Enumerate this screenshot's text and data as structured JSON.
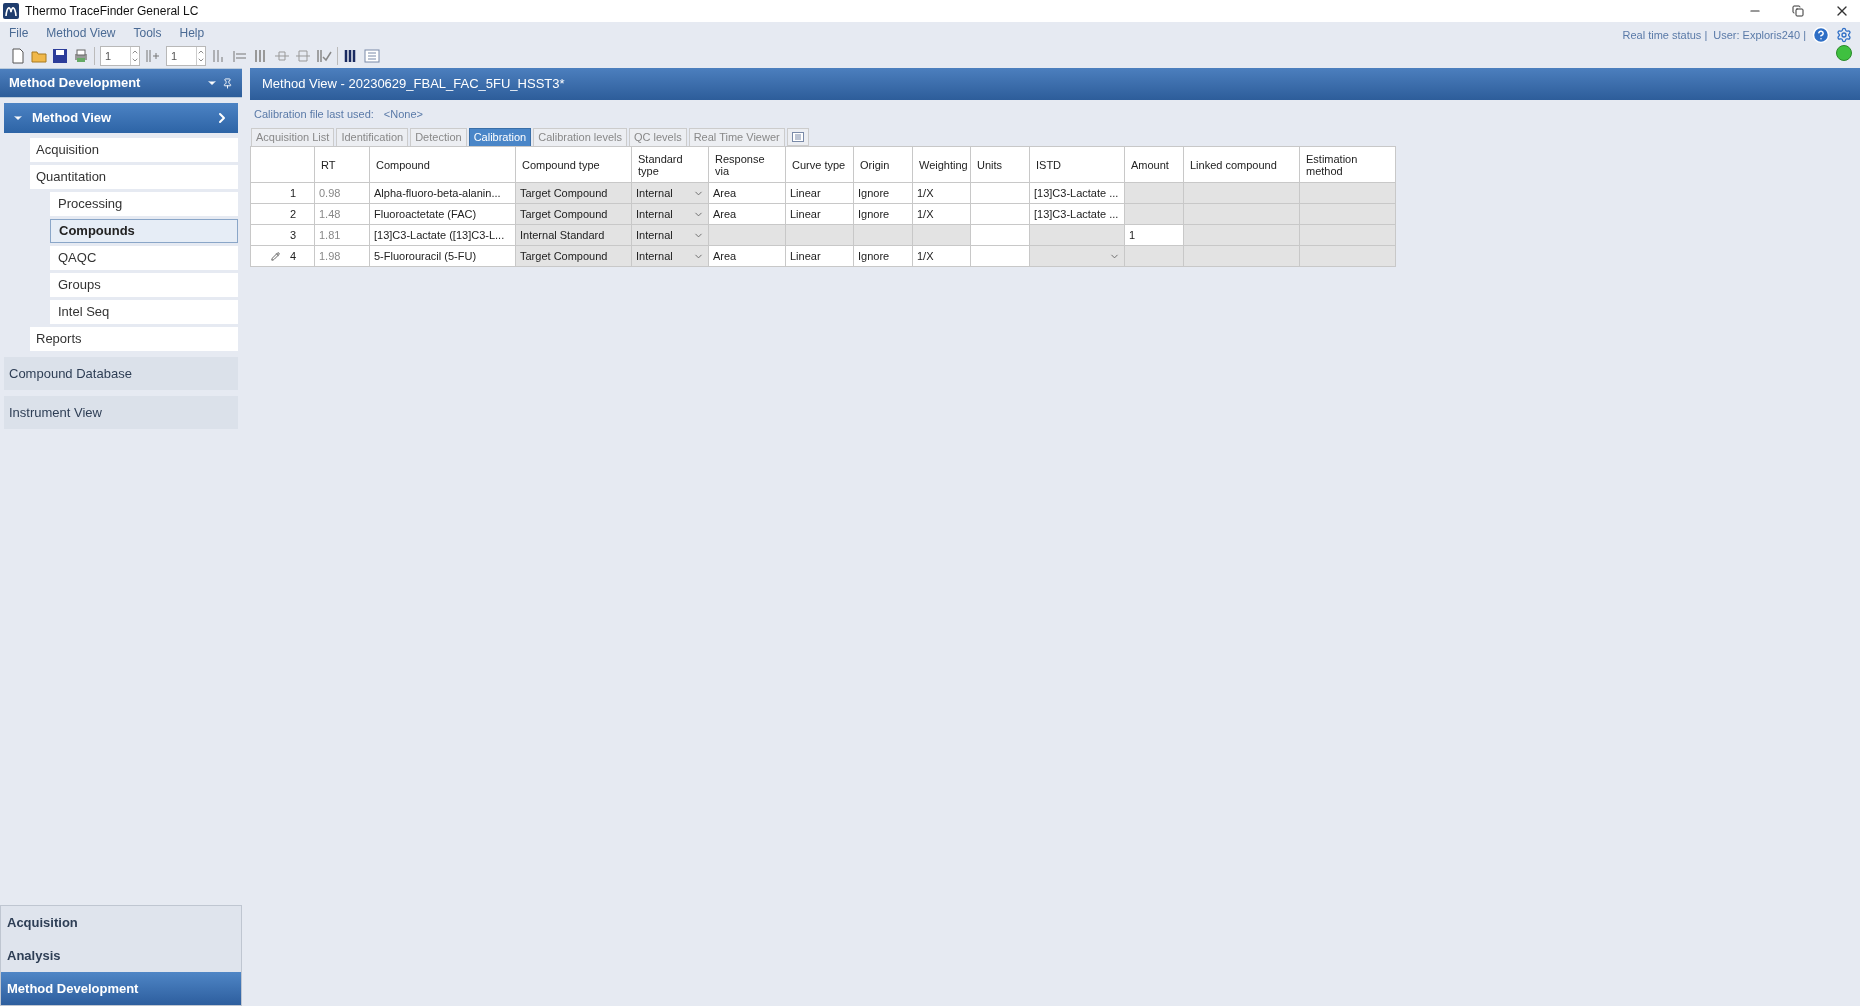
{
  "window": {
    "title": "Thermo TraceFinder General LC"
  },
  "menu": [
    "File",
    "Method View",
    "Tools",
    "Help"
  ],
  "toolbar": {
    "spinners": [
      {
        "value": "1"
      },
      {
        "value": "1"
      }
    ]
  },
  "status": {
    "realtime": "Real time status |",
    "user": "User: Exploris240 |"
  },
  "sidebar": {
    "title": "Method Development",
    "group": {
      "label": "Method View",
      "expanded": true
    },
    "items": [
      {
        "label": "Acquisition",
        "selected": false
      },
      {
        "label": "Quantitation",
        "selected": false,
        "children": [
          {
            "label": "Processing",
            "selected": false
          },
          {
            "label": "Compounds",
            "selected": true
          },
          {
            "label": "QAQC",
            "selected": false
          },
          {
            "label": "Groups",
            "selected": false
          },
          {
            "label": "Intel Seq",
            "selected": false
          }
        ]
      },
      {
        "label": "Reports",
        "selected": false
      }
    ],
    "sections": [
      "Compound Database",
      "Instrument View"
    ],
    "nav": [
      {
        "label": "Acquisition",
        "selected": false
      },
      {
        "label": "Analysis",
        "selected": false
      },
      {
        "label": "Method Development",
        "selected": true
      }
    ]
  },
  "main": {
    "title": "Method View - 20230629_FBAL_FAC_5FU_HSST3*",
    "calibration_label": "Calibration file last used:",
    "calibration_value": "<None>",
    "tabs": [
      {
        "label": "Acquisition List",
        "selected": false
      },
      {
        "label": "Identification",
        "selected": false
      },
      {
        "label": "Detection",
        "selected": false
      },
      {
        "label": "Calibration",
        "selected": true
      },
      {
        "label": "Calibration levels",
        "selected": false
      },
      {
        "label": "QC levels",
        "selected": false
      },
      {
        "label": "Real Time Viewer",
        "selected": false
      }
    ],
    "table": {
      "columns": [
        "RT",
        "Compound",
        "Compound type",
        "Standard type",
        "Response via",
        "Curve type",
        "Origin",
        "Weighting",
        "Units",
        "ISTD",
        "Amount",
        "Linked compound",
        "Estimation method"
      ],
      "rows": [
        {
          "number": "1",
          "editing": false,
          "cells": [
            {
              "text": "0.98",
              "kind": "readonly",
              "shaded": false
            },
            {
              "text": "Alpha-fluoro-beta-alanin...",
              "kind": "text",
              "shaded": false
            },
            {
              "text": "Target Compound",
              "kind": "text",
              "shaded": true
            },
            {
              "text": "Internal",
              "kind": "dropdown",
              "shaded": true
            },
            {
              "text": "Area",
              "kind": "text",
              "shaded": false
            },
            {
              "text": "Linear",
              "kind": "text",
              "shaded": false
            },
            {
              "text": "Ignore",
              "kind": "text",
              "shaded": false
            },
            {
              "text": "1/X",
              "kind": "text",
              "shaded": false
            },
            {
              "kind": "text",
              "shaded": false
            },
            {
              "text": "[13]C3-Lactate ...",
              "kind": "text",
              "shaded": false
            },
            {
              "kind": "text",
              "shaded": true
            },
            {
              "kind": "text",
              "shaded": true
            },
            {
              "kind": "text",
              "shaded": true
            }
          ]
        },
        {
          "number": "2",
          "editing": false,
          "cells": [
            {
              "text": "1.48",
              "kind": "readonly",
              "shaded": false
            },
            {
              "text": "Fluoroactetate (FAC)",
              "kind": "text",
              "shaded": false
            },
            {
              "text": "Target Compound",
              "kind": "text",
              "shaded": true
            },
            {
              "text": "Internal",
              "kind": "dropdown",
              "shaded": true
            },
            {
              "text": "Area",
              "kind": "text",
              "shaded": false
            },
            {
              "text": "Linear",
              "kind": "text",
              "shaded": false
            },
            {
              "text": "Ignore",
              "kind": "text",
              "shaded": false
            },
            {
              "text": "1/X",
              "kind": "text",
              "shaded": false
            },
            {
              "kind": "text",
              "shaded": false
            },
            {
              "text": "[13]C3-Lactate ...",
              "kind": "text",
              "shaded": false
            },
            {
              "kind": "text",
              "shaded": true
            },
            {
              "kind": "text",
              "shaded": true
            },
            {
              "kind": "text",
              "shaded": true
            }
          ]
        },
        {
          "number": "3",
          "editing": false,
          "cells": [
            {
              "text": "1.81",
              "kind": "readonly",
              "shaded": false
            },
            {
              "text": "[13]C3-Lactate ([13]C3-L...",
              "kind": "text",
              "shaded": false
            },
            {
              "text": "Internal Standard",
              "kind": "text",
              "shaded": true
            },
            {
              "text": "Internal",
              "kind": "dropdown",
              "shaded": true
            },
            {
              "kind": "text",
              "shaded": true
            },
            {
              "kind": "text",
              "shaded": true
            },
            {
              "kind": "text",
              "shaded": true
            },
            {
              "kind": "text",
              "shaded": true
            },
            {
              "kind": "text",
              "shaded": false
            },
            {
              "kind": "text",
              "shaded": true
            },
            {
              "text": "1",
              "kind": "text",
              "shaded": false
            },
            {
              "kind": "text",
              "shaded": true
            },
            {
              "kind": "text",
              "shaded": true
            }
          ]
        },
        {
          "number": "4",
          "editing": true,
          "cells": [
            {
              "text": "1.98",
              "kind": "readonly",
              "shaded": false
            },
            {
              "text": "5-Fluorouracil (5-FU)",
              "kind": "text",
              "shaded": false
            },
            {
              "text": "Target Compound",
              "kind": "text",
              "shaded": true
            },
            {
              "text": "Internal",
              "kind": "dropdown",
              "shaded": true
            },
            {
              "text": "Area",
              "kind": "text",
              "shaded": false
            },
            {
              "text": "Linear",
              "kind": "text",
              "shaded": false
            },
            {
              "text": "Ignore",
              "kind": "text",
              "shaded": false
            },
            {
              "text": "1/X",
              "kind": "text",
              "shaded": false
            },
            {
              "kind": "text",
              "shaded": false
            },
            {
              "kind": "dropdown",
              "shaded": true
            },
            {
              "kind": "text",
              "shaded": true
            },
            {
              "kind": "text",
              "shaded": true
            },
            {
              "kind": "text",
              "shaded": true
            }
          ]
        }
      ]
    }
  }
}
